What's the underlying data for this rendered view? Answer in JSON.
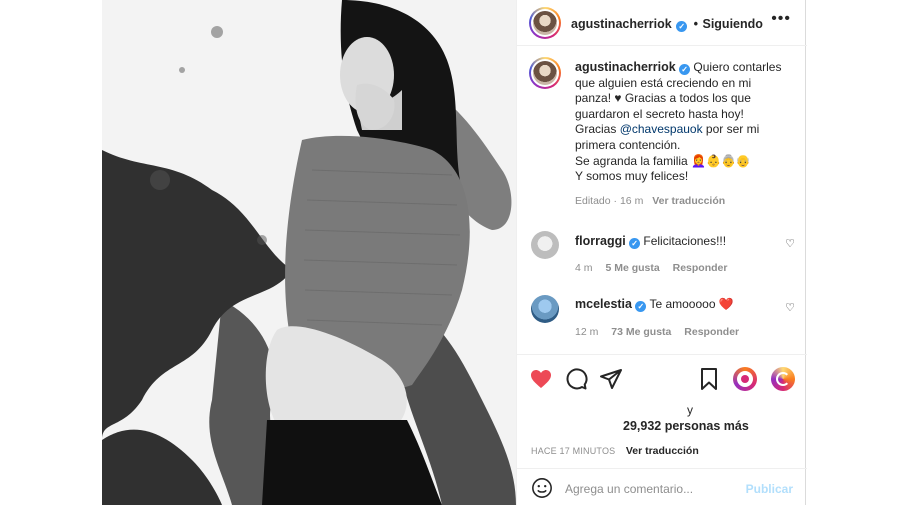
{
  "post": {
    "username": "agustinacherriok",
    "follow_status": "Siguiendo",
    "more_label": "•••"
  },
  "caption": {
    "line1": "Quiero contarles",
    "line2": "que alguien está creciendo en mi",
    "line3": "panza! ♥ Gracias a todos los que",
    "line4": "guardaron el secreto hasta hoy!",
    "line5_pre": "Gracias ",
    "mention": "@chavespauok",
    "line5_post": " por ser mi",
    "line6": "primera contención.",
    "line7": "Se agranda la familia 👩‍🦰👶👵👴",
    "line8": "Y somos muy felices!",
    "edited": "Editado",
    "time": "16 m",
    "translate": "Ver traducción"
  },
  "comments": [
    {
      "username": "florraggi",
      "text": "Felicitaciones!!!",
      "time": "4 m",
      "likes": "5 Me gusta",
      "reply": "Responder"
    },
    {
      "username": "mcelestia",
      "text": "Te amooooo ❤️",
      "time": "12 m",
      "likes": "73 Me gusta",
      "reply": "Responder"
    }
  ],
  "likes": {
    "conjunction": "y",
    "count": "29,932 personas más",
    "timestamp": "HACE 17 MINUTOS",
    "translate": "Ver traducción"
  },
  "composer": {
    "placeholder": "Agrega un comentario...",
    "publish_label": "Publicar"
  },
  "icons": {
    "like": "heart-filled-icon",
    "comment": "comment-bubble-icon",
    "share": "paper-plane-icon",
    "save": "bookmark-icon",
    "emoji": "emoji-smile-icon"
  },
  "colors": {
    "like_red": "#ed4956",
    "verified_blue": "#3897f0",
    "mention_blue": "#00376b",
    "publish_disabled": "#b2dffc"
  }
}
